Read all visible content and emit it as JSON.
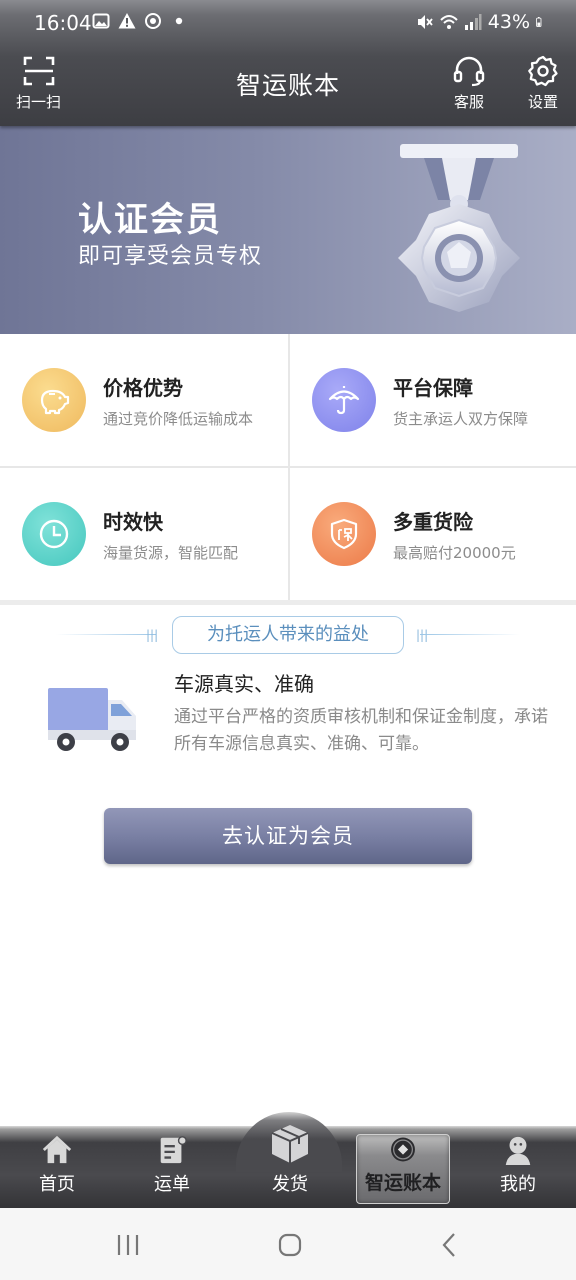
{
  "status_bar": {
    "time": "16:04",
    "battery": "43%",
    "left_icons": [
      "image-icon",
      "warning-icon",
      "sync-icon",
      "dot-icon"
    ],
    "right_icons": [
      "mute-icon",
      "wifi-icon",
      "signal-icon",
      "battery-icon"
    ]
  },
  "header": {
    "title": "智运账本",
    "scan_label": "扫一扫",
    "service_label": "客服",
    "settings_label": "设置"
  },
  "banner": {
    "title": "认证会员",
    "subtitle": "即可享受会员专权"
  },
  "benefits": [
    {
      "title": "价格优势",
      "desc": "通过竞价降低运输成本",
      "icon": "piggy-bank-icon",
      "color": "#f1c069"
    },
    {
      "title": "平台保障",
      "desc": "货主承运人双方保障",
      "icon": "umbrella-icon",
      "color": "#8c8ff0"
    },
    {
      "title": "时效快",
      "desc": "海量货源，智能匹配",
      "icon": "clock-icon",
      "color": "#55cfc6"
    },
    {
      "title": "多重货险",
      "desc": "最高赔付20000元",
      "icon": "insurance-shield-icon",
      "color": "#f08a5a"
    }
  ],
  "advantage": {
    "header": "为托运人带来的益处",
    "title": "车源真实、准确",
    "text": "通过平台严格的资质审核机制和保证金制度，承诺所有车源信息真实、准确、可靠。"
  },
  "cta": {
    "label": "去认证为会员"
  },
  "tabs": [
    {
      "label": "首页",
      "icon": "home-icon"
    },
    {
      "label": "运单",
      "icon": "waybill-icon"
    },
    {
      "label": "发货",
      "icon": "package-icon"
    },
    {
      "label": "智运账本",
      "icon": "ledger-icon",
      "active": true
    },
    {
      "label": "我的",
      "icon": "profile-icon"
    }
  ]
}
